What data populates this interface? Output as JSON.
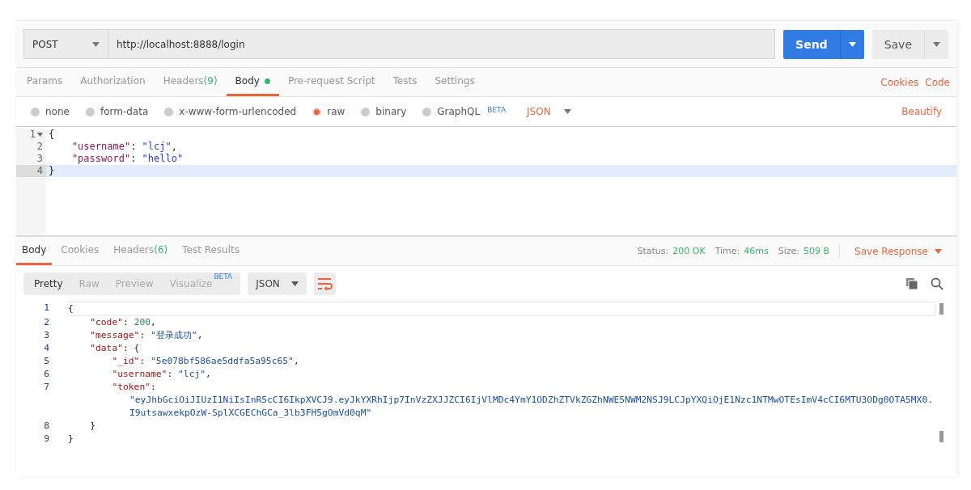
{
  "request": {
    "method": "POST",
    "url": "http://localhost:8888/login",
    "send_label": "Send",
    "save_label": "Save"
  },
  "request_tabs": [
    {
      "label": "Params",
      "selected": false
    },
    {
      "label": "Authorization",
      "selected": false
    },
    {
      "label": "Headers",
      "count": "(9)",
      "selected": false
    },
    {
      "label": "Body",
      "selected": true,
      "has_content": true
    },
    {
      "label": "Pre-request Script",
      "selected": false
    },
    {
      "label": "Tests",
      "selected": false
    },
    {
      "label": "Settings",
      "selected": false
    }
  ],
  "request_links": [
    "Cookies",
    "Code"
  ],
  "body_modes": [
    {
      "label": "none",
      "selected": false
    },
    {
      "label": "form-data",
      "selected": false
    },
    {
      "label": "x-www-form-urlencoded",
      "selected": false
    },
    {
      "label": "raw",
      "selected": true
    },
    {
      "label": "binary",
      "selected": false
    },
    {
      "label": "GraphQL",
      "badge": "BETA",
      "selected": false
    }
  ],
  "body_language": "JSON",
  "beautify": "Beautify",
  "request_body": [
    {
      "number": "1",
      "foldable": true,
      "active": false,
      "tokens": [
        {
          "kind": "punct",
          "text": "{"
        }
      ]
    },
    {
      "number": "2",
      "active": false,
      "tokens": [
        {
          "kind": "key",
          "text": "    \"username\""
        },
        {
          "kind": "punct",
          "text": ": "
        },
        {
          "kind": "string",
          "text": "\"lcj\""
        },
        {
          "kind": "punct",
          "text": ","
        }
      ]
    },
    {
      "number": "3",
      "active": false,
      "tokens": [
        {
          "kind": "key",
          "text": "    \"password\""
        },
        {
          "kind": "punct",
          "text": ": "
        },
        {
          "kind": "string",
          "text": "\"hello\""
        }
      ]
    },
    {
      "number": "4",
      "active": true,
      "tokens": [
        {
          "kind": "punct",
          "text": "}"
        }
      ]
    }
  ],
  "response_tabs": [
    {
      "label": "Body",
      "selected": true
    },
    {
      "label": "Cookies",
      "selected": false
    },
    {
      "label": "Headers",
      "count": "(6)",
      "selected": false
    },
    {
      "label": "Test Results",
      "selected": false
    }
  ],
  "response_status": [
    {
      "label": "Status:",
      "value": "200 OK"
    },
    {
      "label": "Time:",
      "value": "46ms"
    },
    {
      "label": "Size:",
      "value": "509 B"
    }
  ],
  "save_response": "Save Response",
  "view_modes": [
    {
      "label": "Pretty",
      "selected": true
    },
    {
      "label": "Raw",
      "selected": false
    },
    {
      "label": "Preview",
      "selected": false
    },
    {
      "label": "Visualize",
      "badge": "BETA",
      "selected": false
    }
  ],
  "response_language": "JSON",
  "response_body": [
    {
      "number": "1",
      "active": true,
      "tokens": [
        {
          "kind": "punct",
          "text": "{"
        }
      ]
    },
    {
      "number": "2",
      "active": false,
      "tokens": [
        {
          "kind": "key",
          "text": "    \"code\""
        },
        {
          "kind": "punct",
          "text": ": "
        },
        {
          "kind": "number",
          "text": "200"
        },
        {
          "kind": "punct",
          "text": ","
        }
      ]
    },
    {
      "number": "3",
      "active": false,
      "tokens": [
        {
          "kind": "key",
          "text": "    \"message\""
        },
        {
          "kind": "punct",
          "text": ": "
        },
        {
          "kind": "string",
          "text": "\"登录成功\""
        },
        {
          "kind": "punct",
          "text": ","
        }
      ]
    },
    {
      "number": "4",
      "active": false,
      "tokens": [
        {
          "kind": "key",
          "text": "    \"data\""
        },
        {
          "kind": "punct",
          "text": ": {"
        }
      ]
    },
    {
      "number": "5",
      "active": false,
      "tokens": [
        {
          "kind": "key",
          "text": "        \"_id\""
        },
        {
          "kind": "punct",
          "text": ": "
        },
        {
          "kind": "string",
          "text": "\"5e078bf586ae5ddfa5a95c65\""
        },
        {
          "kind": "punct",
          "text": ","
        }
      ]
    },
    {
      "number": "6",
      "active": false,
      "tokens": [
        {
          "kind": "key",
          "text": "        \"username\""
        },
        {
          "kind": "punct",
          "text": ": "
        },
        {
          "kind": "string",
          "text": "\"lcj\""
        },
        {
          "kind": "punct",
          "text": ","
        }
      ]
    },
    {
      "number": "7",
      "active": false,
      "tokens": [
        {
          "kind": "key",
          "text": "        \"token\""
        },
        {
          "kind": "punct",
          "text": ":"
        }
      ]
    },
    {
      "active": false,
      "tokens": [
        {
          "kind": "wrapped",
          "text": "\"eyJhbGciOiJIUzI1NiIsInR5cCI6IkpXVCJ9.eyJkYXRhIjp7InVzZXJJZCI6IjVlMDc4YmY1ODZhZTVkZGZhNWE5NWM2NSJ9LCJpYXQiOjE1Nzc1NTMwOTEsImV4cCI6MTU3ODg0OTA5MX0.I9utsawxekpOzW-SplXCGEChGCa_3lb3FH5gOmVd0qM\""
        }
      ]
    },
    {
      "number": "8",
      "active": false,
      "tokens": [
        {
          "kind": "punct",
          "text": "    }"
        }
      ]
    },
    {
      "number": "9",
      "active": false,
      "tokens": [
        {
          "kind": "punct",
          "text": "}"
        }
      ]
    }
  ]
}
